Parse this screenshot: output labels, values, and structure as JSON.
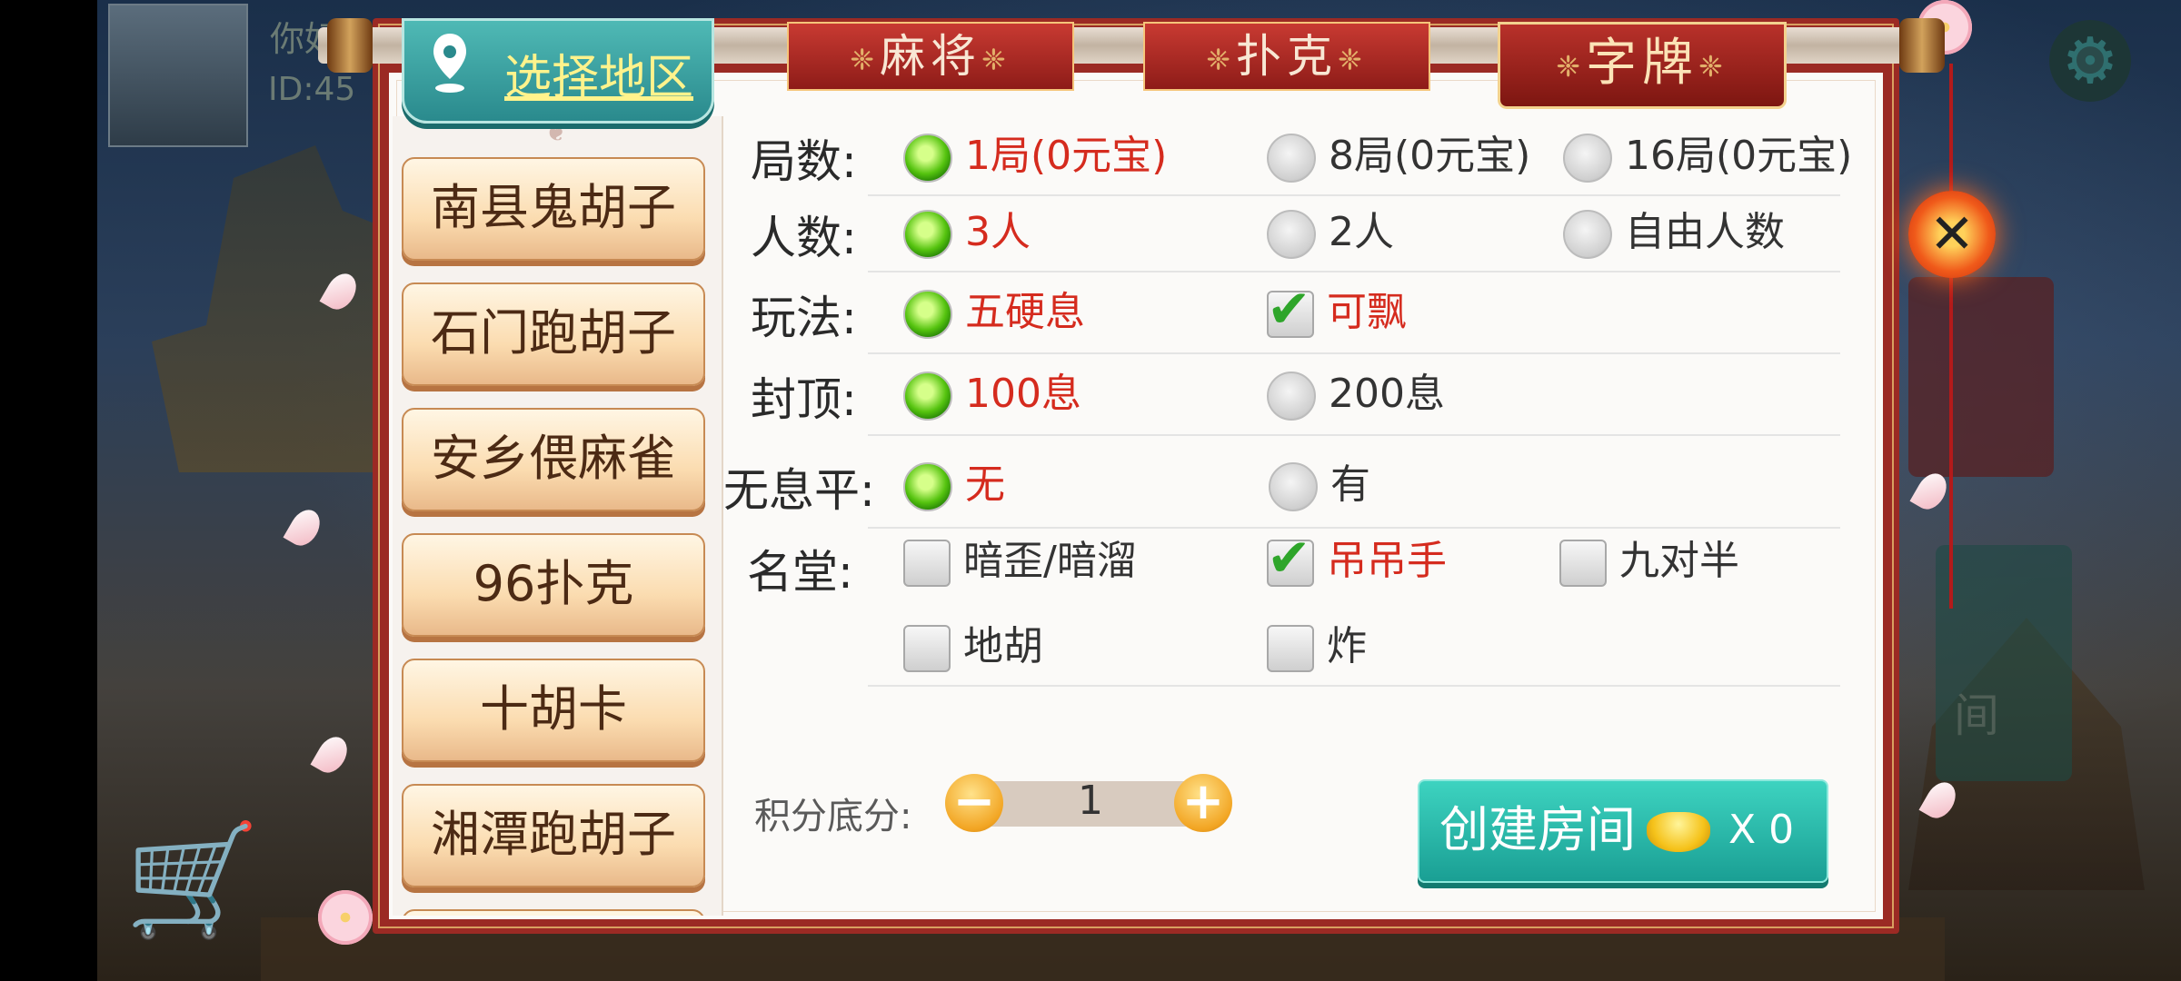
{
  "background": {
    "greeting": "你好",
    "id_text": "ID:45"
  },
  "region_tab": {
    "label": "选择地区"
  },
  "game_tabs": [
    {
      "label": "麻将",
      "active": false
    },
    {
      "label": "扑克",
      "active": false
    },
    {
      "label": "字牌",
      "active": true
    }
  ],
  "sidebar": {
    "regions": [
      "南县鬼胡子",
      "石门跑胡子",
      "安乡偎麻雀",
      "96扑克",
      "十胡卡",
      "湘潭跑胡子"
    ]
  },
  "options": {
    "rounds": {
      "label": "局数:",
      "choices": [
        "1局(0元宝)",
        "8局(0元宝)",
        "16局(0元宝)"
      ],
      "selected": "1局(0元宝)"
    },
    "players": {
      "label": "人数:",
      "choices": [
        "3人",
        "2人",
        "自由人数"
      ],
      "selected": "3人"
    },
    "play": {
      "label": "玩法:",
      "radio": "五硬息",
      "checkbox": "可飘",
      "checkbox_checked": true
    },
    "cap": {
      "label": "封顶:",
      "choices": [
        "100息",
        "200息"
      ],
      "selected": "100息"
    },
    "no_xi_ping": {
      "label": "无息平:",
      "choices": [
        "无",
        "有"
      ],
      "selected": "无"
    },
    "ming_tang": {
      "label": "名堂:",
      "items": [
        {
          "text": "暗歪/暗溜",
          "checked": false
        },
        {
          "text": "吊吊手",
          "checked": true
        },
        {
          "text": "九对半",
          "checked": false
        },
        {
          "text": "地胡",
          "checked": false
        },
        {
          "text": "炸",
          "checked": false
        }
      ]
    }
  },
  "score": {
    "label": "积分底分:",
    "value": "1",
    "minus": "−",
    "plus": "+"
  },
  "create": {
    "label": "创建房间",
    "count": "X 0"
  },
  "close": {
    "symbol": "✕"
  },
  "colors": {
    "selected_text": "#d52b1e",
    "panel_frame": "#9b2a24",
    "create_button": "#1a9f94",
    "region_tab": "#2a8a8d"
  }
}
